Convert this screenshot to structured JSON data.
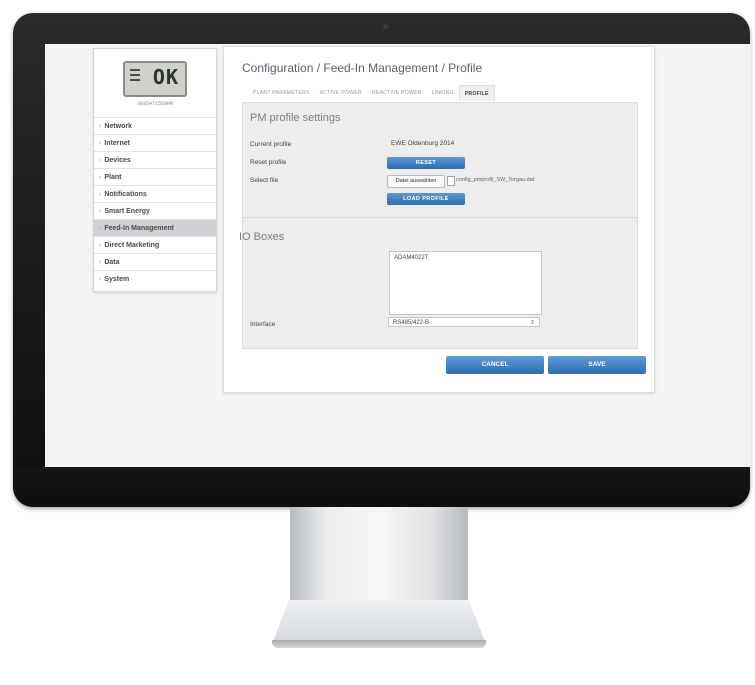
{
  "device": {
    "display": "OK",
    "serial": "3035471559HM"
  },
  "sidebar": {
    "items": [
      {
        "label": "Network"
      },
      {
        "label": "Internet"
      },
      {
        "label": "Devices"
      },
      {
        "label": "Plant"
      },
      {
        "label": "Notifications"
      },
      {
        "label": "Smart Energy"
      },
      {
        "label": "Feed-In Management",
        "active": true
      },
      {
        "label": "Direct Marketing"
      },
      {
        "label": "Data"
      },
      {
        "label": "System"
      }
    ]
  },
  "header": {
    "breadcrumb": "Configuration / Feed-In Management / Profile"
  },
  "tabs": [
    {
      "label": "PLANT PARAMETERS"
    },
    {
      "label": "ACTIVE POWER"
    },
    {
      "label": "REACTIVE POWER"
    },
    {
      "label": "LINKING"
    },
    {
      "label": "PROFILE",
      "active": true
    }
  ],
  "pm_profile": {
    "title": "PM profile settings",
    "current_profile_label": "Current profile",
    "current_profile_value": "EWE Oldenburg 2014",
    "reset_label": "Reset profile",
    "reset_button": "RESET",
    "select_file_label": "Select file",
    "file_button": "Datei auswählen",
    "file_name": "config_pmprofil_SW_Torgau.dat",
    "load_button": "LOAD PROFILE"
  },
  "io_boxes": {
    "title": "IO Boxes",
    "list_item": "ADAM4022T",
    "interface_label": "Interface",
    "interface_value": "RS485/422-B"
  },
  "footer": {
    "cancel": "CANCEL",
    "save": "SAVE"
  },
  "colors": {
    "accent": "#3d7cc2",
    "active_menu": "#cfd1d4",
    "panel_bg": "#ededee"
  }
}
